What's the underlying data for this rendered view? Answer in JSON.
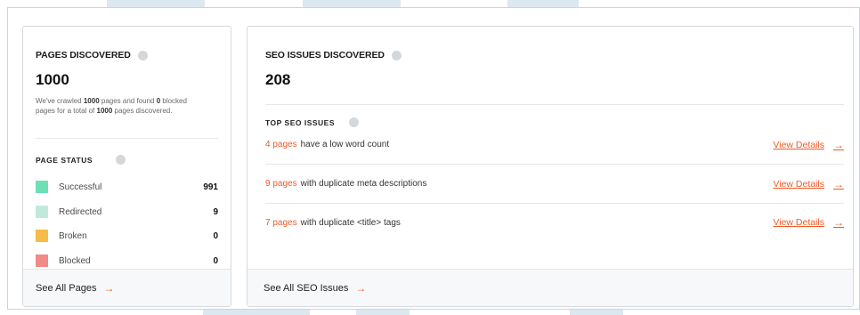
{
  "left_card": {
    "title": "PAGES DISCOVERED",
    "total": "1000",
    "desc_1": "We've crawled ",
    "desc_crawled": "1000",
    "desc_2": " pages and found ",
    "desc_blocked": "0",
    "desc_3": " blocked pages for a total of ",
    "desc_total": "1000",
    "desc_4": " pages discovered.",
    "status_title": "PAGE STATUS",
    "statuses": [
      {
        "label": "Successful",
        "value": "991",
        "color": "#6fe0b6"
      },
      {
        "label": "Redirected",
        "value": "9",
        "color": "#bfeadb"
      },
      {
        "label": "Broken",
        "value": "0",
        "color": "#f6bb48"
      },
      {
        "label": "Blocked",
        "value": "0",
        "color": "#f08b89"
      }
    ],
    "footer_link": "See All Pages"
  },
  "right_card": {
    "title": "SEO ISSUES DISCOVERED",
    "total": "208",
    "top_title": "TOP SEO ISSUES",
    "issues": [
      {
        "count": "4 pages",
        "text": "have a low word count",
        "link": "View Details"
      },
      {
        "count": "9 pages",
        "text": "with duplicate meta descriptions",
        "link": "View Details"
      },
      {
        "count": "7 pages",
        "text": "with duplicate <title> tags",
        "link": "View Details"
      }
    ],
    "footer_link": "See All SEO Issues"
  },
  "icons": {
    "arrow": "→"
  }
}
